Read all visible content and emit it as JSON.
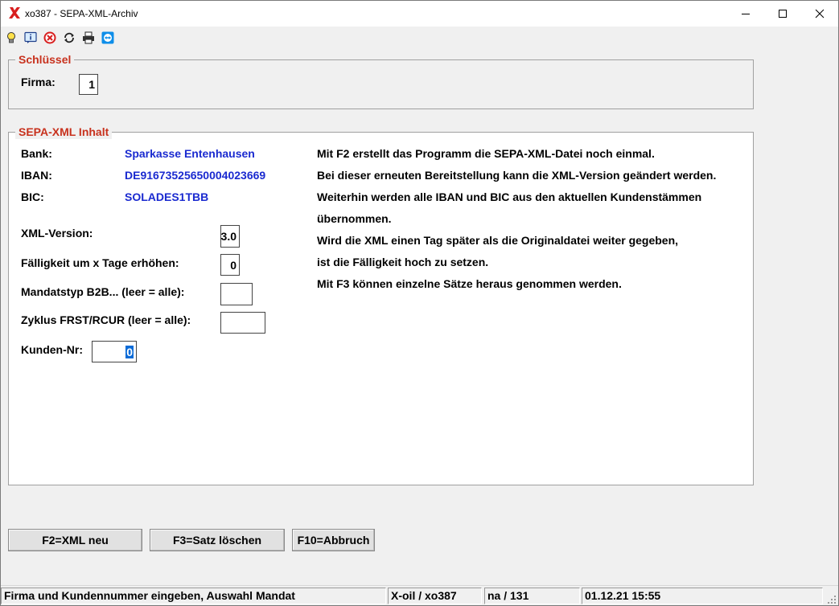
{
  "window": {
    "title": "xo387 - SEPA-XML-Archiv"
  },
  "toolbar": {
    "icons": [
      "lightbulb-icon",
      "info-icon",
      "cancel-icon",
      "refresh-icon",
      "printer-icon",
      "teamviewer-icon"
    ]
  },
  "key_group": {
    "legend": "Schlüssel",
    "firma_label": "Firma:",
    "firma_value": "1"
  },
  "content_group": {
    "legend": "SEPA-XML Inhalt",
    "bank_label": "Bank:",
    "bank_value": "Sparkasse Entenhausen",
    "iban_label": "IBAN:",
    "iban_value": "DE91673525650004023669",
    "bic_label": "BIC:",
    "bic_value": "SOLADES1TBB",
    "xml_version_label": "XML-Version:",
    "xml_version_value": "3.0",
    "faelligkeit_label": "Fälligkeit um x Tage erhöhen:",
    "faelligkeit_value": "0",
    "mandatstyp_label": "Mandatstyp B2B... (leer = alle):",
    "mandatstyp_value": "",
    "zyklus_label": "Zyklus FRST/RCUR (leer = alle):",
    "zyklus_value": "",
    "kunden_label": "Kunden-Nr:",
    "kunden_value": "0",
    "info_lines": [
      "Mit F2 erstellt das Programm die SEPA-XML-Datei noch einmal.",
      "Bei dieser erneuten Bereitstellung kann die XML-Version geändert werden.",
      "Weiterhin werden alle IBAN und BIC aus den aktuellen Kundenstämmen",
      "übernommen.",
      "Wird die XML einen Tag später als die Originaldatei weiter gegeben,",
      "ist die Fälligkeit hoch zu setzen.",
      "Mit F3 können einzelne Sätze heraus genommen werden."
    ]
  },
  "buttons": {
    "f2": "F2=XML neu",
    "f3": "F3=Satz löschen",
    "f10": "F10=Abbruch"
  },
  "statusbar": {
    "message": "Firma und Kundennummer eingeben, Auswahl Mandat",
    "app": "X-oil / xo387",
    "user": "na / 131",
    "datetime": "01.12.21 15:55"
  },
  "colors": {
    "legend": "#c8321e",
    "value_blue": "#1a2ad0",
    "selection": "#0a6bd7"
  }
}
